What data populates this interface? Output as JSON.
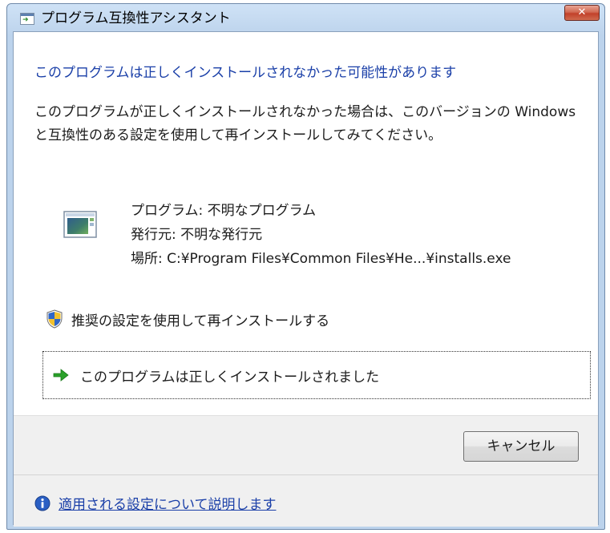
{
  "window": {
    "title": "プログラム互換性アシスタント",
    "close_label": "✕"
  },
  "main": {
    "heading": "このプログラムは正しくインストールされなかった可能性があります",
    "description": "このプログラムが正しくインストールされなかった場合は、このバージョンの Windows と互換性のある設定を使用して再インストールしてみてください。",
    "program_line": "プログラム: 不明なプログラム",
    "publisher_line": "発行元: 不明な発行元",
    "location_line": "場所: C:¥Program Files¥Common Files¥He...¥installs.exe",
    "reinstall_option": "推奨の設定を使用して再インストールする",
    "installed_option": "このプログラムは正しくインストールされました"
  },
  "footer": {
    "cancel_label": "キャンセル",
    "help_link": "適用される設定について説明します"
  },
  "icons": {
    "title": "compatibility-window-icon",
    "program": "program-window-icon",
    "shield": "uac-shield-icon",
    "arrow": "green-arrow-icon",
    "info": "info-icon"
  },
  "colors": {
    "heading": "#1a3fa8",
    "link": "#1a3fa8",
    "close_button": "#c2412a"
  }
}
